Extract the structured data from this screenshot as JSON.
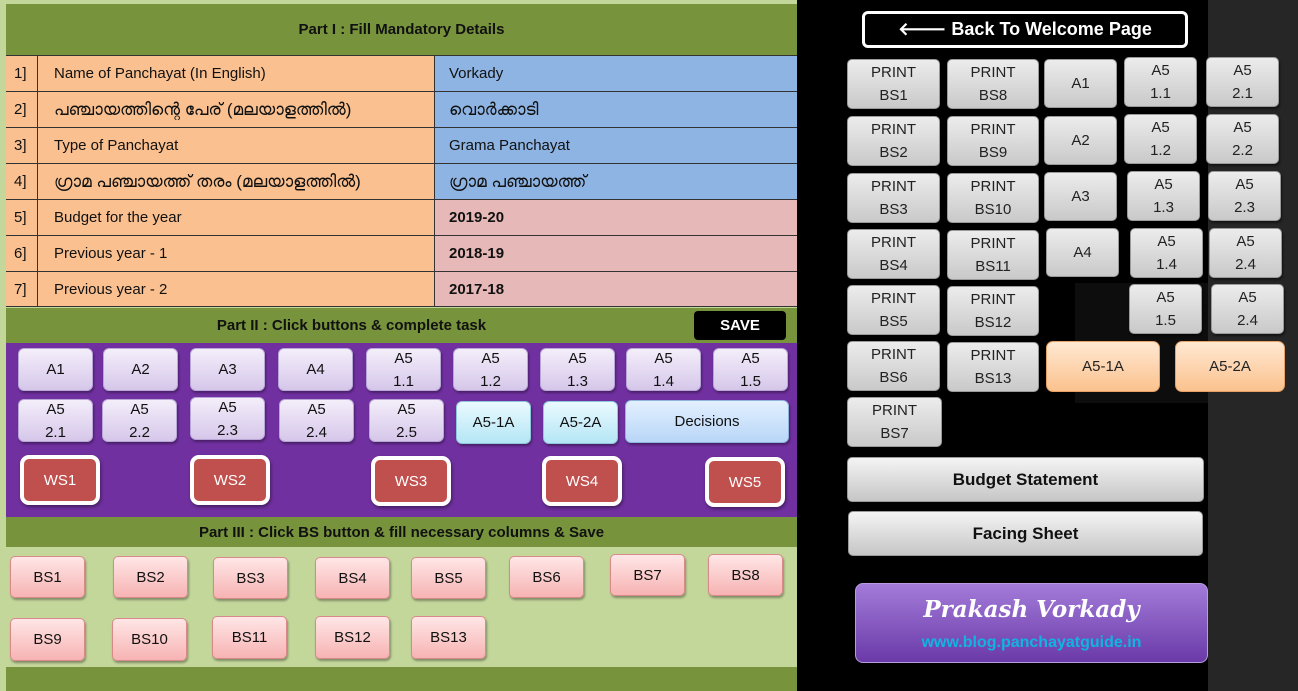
{
  "part1": {
    "title": "Part I : Fill Mandatory Details",
    "rows": [
      {
        "num": "1]",
        "label": "Name of Panchayat (In English)",
        "value": "Vorkady"
      },
      {
        "num": "2]",
        "label": "പഞ്ചായത്തിന്റെ പേര് (മലയാളത്തിൽ)",
        "value": "വൊർക്കാടി"
      },
      {
        "num": "3]",
        "label": "Type of Panchayat",
        "value": "Grama Panchayat"
      },
      {
        "num": "4]",
        "label": "ഗ്രാമ പഞ്ചായത്ത് തരം (മലയാളത്തിൽ)",
        "value": "ഗ്രാമ പഞ്ചായത്ത്"
      },
      {
        "num": "5]",
        "label": "Budget for the year",
        "value": "2019-20"
      },
      {
        "num": "6]",
        "label": "Previous year - 1",
        "value": "2018-19"
      },
      {
        "num": "7]",
        "label": "Previous year - 2",
        "value": "2017-18"
      }
    ]
  },
  "part2": {
    "title": "Part II : Click buttons & complete task",
    "save_label": "SAVE",
    "row1": [
      "A1",
      "A2",
      "A3",
      "A4",
      "A5\n1.1",
      "A5\n1.2",
      "A5\n1.3",
      "A5\n1.4",
      "A5\n1.5"
    ],
    "row2": [
      "A5\n2.1",
      "A5\n2.2",
      "A5\n2.3",
      "A5\n2.4",
      "A5\n2.5"
    ],
    "a5_1a": "A5-1A",
    "a5_2a": "A5-2A",
    "decisions": "Decisions",
    "ws": [
      "WS1",
      "WS2",
      "WS3",
      "WS4",
      "WS5"
    ]
  },
  "part3": {
    "title": "Part III : Click BS button & fill necessary columns & Save",
    "bs_row1": [
      "BS1",
      "BS2",
      "BS3",
      "BS4",
      "BS5",
      "BS6",
      "BS7",
      "BS8"
    ],
    "bs_row2": [
      "BS9",
      "BS10",
      "BS11",
      "BS12",
      "BS13"
    ]
  },
  "right": {
    "back_label": "🡐 Back To Welcome Page",
    "print_col1": [
      "PRINT\nBS1",
      "PRINT\nBS2",
      "PRINT\nBS3",
      "PRINT\nBS4",
      "PRINT\nBS5",
      "PRINT\nBS6",
      "PRINT\nBS7"
    ],
    "print_col2": [
      "PRINT\nBS8",
      "PRINT\nBS9",
      "PRINT\nBS10",
      "PRINT\nBS11",
      "PRINT\nBS12",
      "PRINT\nBS13"
    ],
    "a_col": [
      "A1",
      "A2",
      "A3",
      "A4"
    ],
    "a51_col": [
      "A5\n1.1",
      "A5\n1.2",
      "A5\n1.3",
      "A5\n1.4",
      "A5\n1.5"
    ],
    "a52_col": [
      "A5\n2.1",
      "A5\n2.2",
      "A5\n2.3",
      "A5\n2.4",
      "A5\n2.4"
    ],
    "a5_1a": "A5-1A",
    "a5_2a": "A5-2A",
    "budget_statement": "Budget Statement",
    "facing_sheet": "Facing Sheet"
  },
  "credit": {
    "name": "Prakash Vorkady",
    "url": "www.blog.panchayatguide.in"
  },
  "colors": {
    "green_band": "#77933c",
    "panel_bg": "#c4d79b",
    "purple_panel": "#7030a0",
    "ws_red": "#c0504d",
    "right_bg": "#000000"
  }
}
